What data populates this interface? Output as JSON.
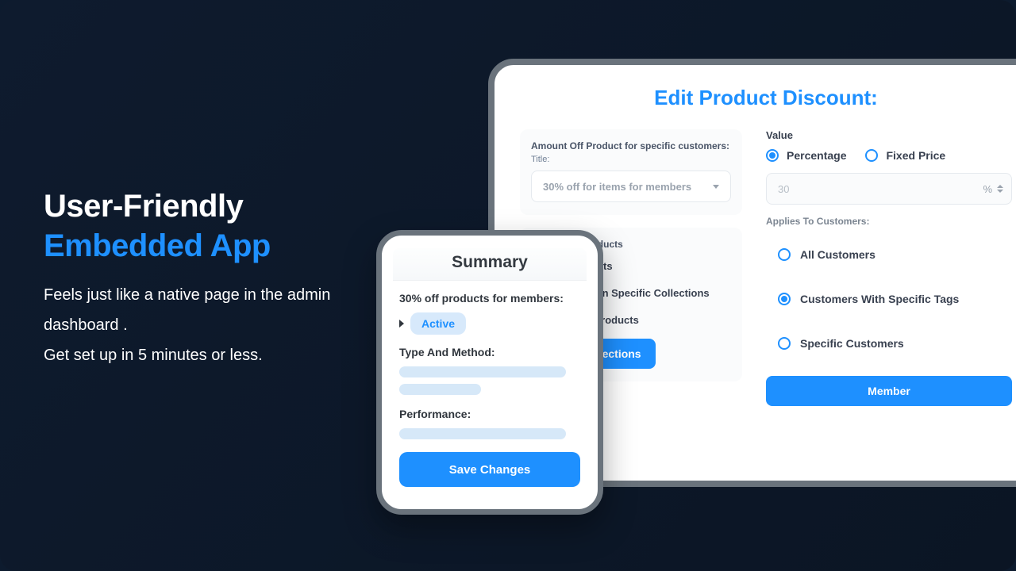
{
  "hero": {
    "line1": "User-Friendly",
    "line2": "Embedded App",
    "body1": "Feels just like a native page in the admin dashboard .",
    "body2": "Get set up in 5 minutes or less."
  },
  "tablet": {
    "title": "Edit Product Discount:",
    "amount_card": {
      "label": "Amount Off Product for specific customers:",
      "title_label": "Title:",
      "selected": "30% off for items for members"
    },
    "applies_card": {
      "label": "Applies To Products",
      "options": {
        "all": "All Products",
        "collections": "Products In Specific Collections",
        "specific": "Specific Products"
      },
      "button": "Select Collections"
    },
    "value": {
      "label": "Value",
      "percentage": "Percentage",
      "fixed": "Fixed Price",
      "amount": "30",
      "unit": "%"
    },
    "customers": {
      "label": "Applies To Customers:",
      "all": "All Customers",
      "tags": "Customers With Specific Tags",
      "specific": "Specific Customers",
      "button": "Member"
    }
  },
  "summary": {
    "heading": "Summary",
    "title": "30% off products for members:",
    "status": "Active",
    "type_label": "Type And Method:",
    "perf_label": "Performance:",
    "save": "Save Changes"
  }
}
